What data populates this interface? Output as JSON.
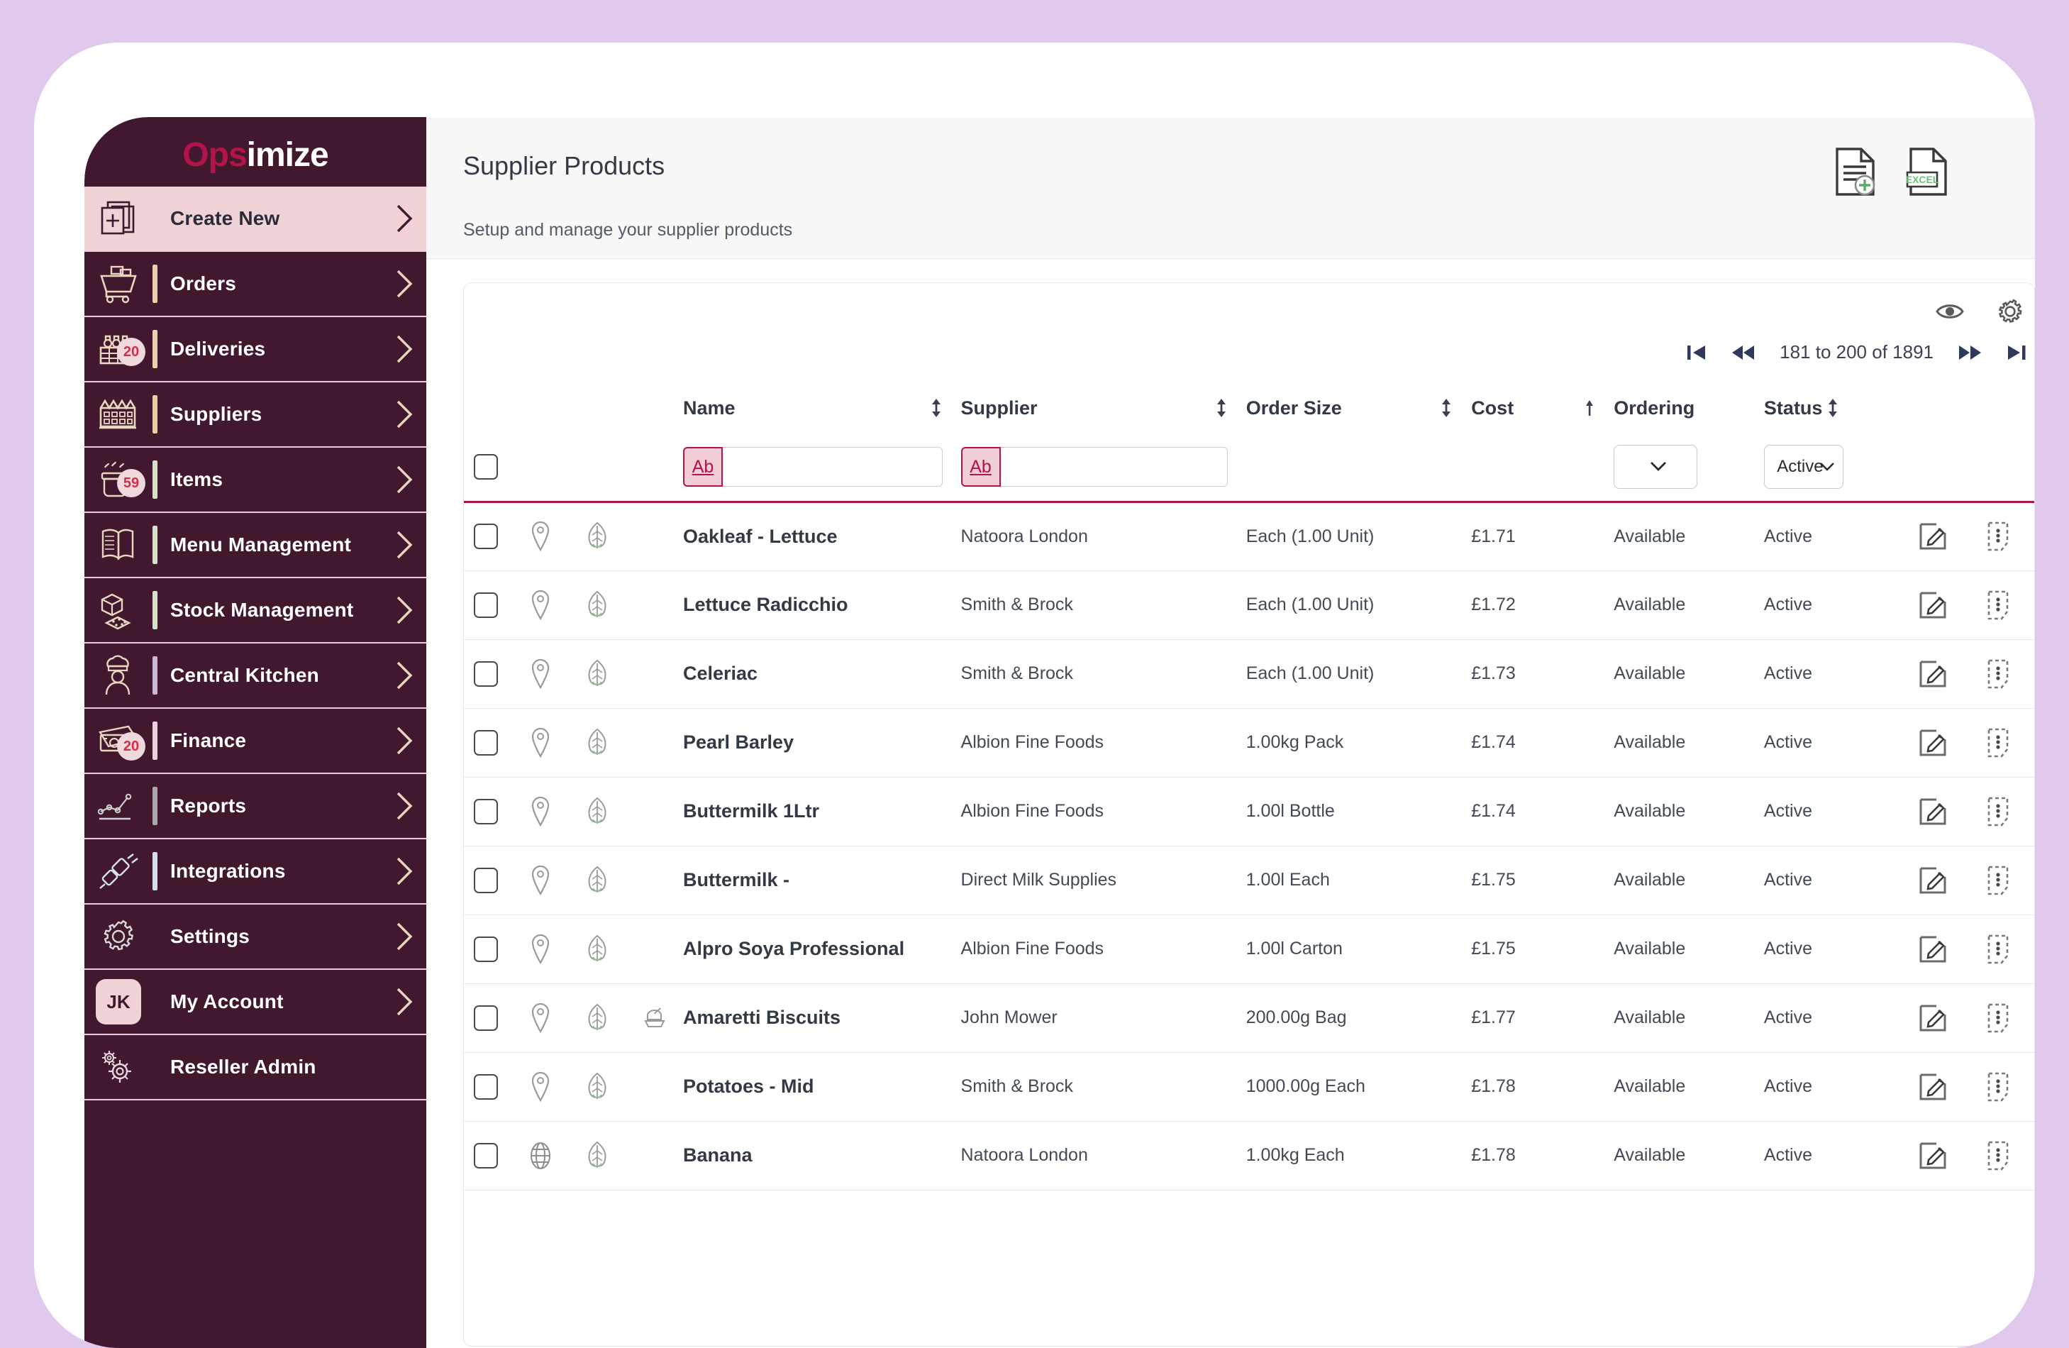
{
  "sidebar": {
    "brand": {
      "prefix": "Ops",
      "suffix": "imize"
    },
    "items": [
      {
        "label": "Create New",
        "icon": "copy-plus-icon",
        "badge": null,
        "accent": "none",
        "active": true,
        "chevron": true
      },
      {
        "label": "Orders",
        "icon": "cart-icon",
        "badge": null,
        "accent": "#e8d2a8",
        "active": false,
        "chevron": true
      },
      {
        "label": "Deliveries",
        "icon": "crate-icon",
        "badge": "20",
        "accent": "#e8d2a8",
        "active": false,
        "chevron": true
      },
      {
        "label": "Suppliers",
        "icon": "factory-icon",
        "badge": null,
        "accent": "#e8cfa0",
        "active": false,
        "chevron": true
      },
      {
        "label": "Items",
        "icon": "pot-icon",
        "badge": "59",
        "accent": "#cfe4c9",
        "active": false,
        "chevron": true
      },
      {
        "label": "Menu Management",
        "icon": "book-icon",
        "badge": null,
        "accent": "#cfe4c9",
        "active": false,
        "chevron": true
      },
      {
        "label": "Stock Management",
        "icon": "cube-icon",
        "badge": null,
        "accent": "#cfe4c9",
        "active": false,
        "chevron": true
      },
      {
        "label": "Central Kitchen",
        "icon": "chef-icon",
        "badge": null,
        "accent": "#c9b6d8",
        "active": false,
        "chevron": true
      },
      {
        "label": "Finance",
        "icon": "banknote-icon",
        "badge": "20",
        "accent": "#e6d2d8",
        "active": false,
        "chevron": true
      },
      {
        "label": "Reports",
        "icon": "linechart-icon",
        "badge": null,
        "accent": "#a9a9a9",
        "active": false,
        "chevron": true
      },
      {
        "label": "Integrations",
        "icon": "plug-icon",
        "badge": null,
        "accent": "#cfe1ef",
        "active": false,
        "chevron": true
      },
      {
        "label": "Settings",
        "icon": "gear-icon",
        "badge": null,
        "accent": "none",
        "active": false,
        "chevron": true
      },
      {
        "label": "My Account",
        "icon": "avatar-initials",
        "badge": null,
        "accent": "none",
        "active": false,
        "chevron": true,
        "initials": "JK"
      },
      {
        "label": "Reseller Admin",
        "icon": "gears-icon",
        "badge": null,
        "accent": "none",
        "active": false,
        "chevron": false
      }
    ]
  },
  "header": {
    "title": "Supplier Products",
    "subtitle": "Setup and manage your supplier products",
    "actions": [
      {
        "name": "new-document-icon",
        "label": ""
      },
      {
        "name": "excel-export-icon",
        "label": "EXCEL"
      }
    ]
  },
  "panel": {
    "tools": [
      {
        "name": "eye-icon"
      },
      {
        "name": "gear-icon"
      }
    ],
    "pagination": {
      "first_label": "⏮",
      "prev_label": "⏪",
      "range_text": "181 to 200 of 1891",
      "next_label": "⏩",
      "last_label": "⏭"
    }
  },
  "table": {
    "columns": [
      {
        "key": "name",
        "label": "Name",
        "sort": "both"
      },
      {
        "key": "supplier",
        "label": "Supplier",
        "sort": "both"
      },
      {
        "key": "ordersize",
        "label": "Order Size",
        "sort": "both"
      },
      {
        "key": "cost",
        "label": "Cost",
        "sort": "asc"
      },
      {
        "key": "ordering",
        "label": "Ordering",
        "sort": "none"
      },
      {
        "key": "status",
        "label": "Status",
        "sort": "both"
      }
    ],
    "filters": {
      "name_button": "Ab",
      "name_value": "",
      "name_placeholder": "",
      "supplier_button": "Ab",
      "supplier_value": "",
      "supplier_placeholder": "",
      "ordering_value": "",
      "status_value": "Active"
    },
    "rows": [
      {
        "name": "Oakleaf - Lettuce",
        "supplier": "Natoora London",
        "ordersize": "Each (1.00 Unit)",
        "cost": "£1.71",
        "ordering": "Available",
        "status": "Active",
        "loc_icon": "pin-icon",
        "leaf_icon": "leaf-icon",
        "extra_icon": null
      },
      {
        "name": "Lettuce Radicchio",
        "supplier": "Smith & Brock",
        "ordersize": "Each (1.00 Unit)",
        "cost": "£1.72",
        "ordering": "Available",
        "status": "Active",
        "loc_icon": "pin-icon",
        "leaf_icon": "leaf-icon",
        "extra_icon": null
      },
      {
        "name": "Celeriac",
        "supplier": "Smith & Brock",
        "ordersize": "Each (1.00 Unit)",
        "cost": "£1.73",
        "ordering": "Available",
        "status": "Active",
        "loc_icon": "pin-icon",
        "leaf_icon": "leaf-icon",
        "extra_icon": null
      },
      {
        "name": "Pearl Barley",
        "supplier": "Albion Fine Foods",
        "ordersize": "1.00kg Pack",
        "cost": "£1.74",
        "ordering": "Available",
        "status": "Active",
        "loc_icon": "pin-icon",
        "leaf_icon": "leaf-icon",
        "extra_icon": null
      },
      {
        "name": "Buttermilk 1Ltr",
        "supplier": "Albion Fine Foods",
        "ordersize": "1.00l Bottle",
        "cost": "£1.74",
        "ordering": "Available",
        "status": "Active",
        "loc_icon": "pin-icon",
        "leaf_icon": "leaf-icon",
        "extra_icon": null
      },
      {
        "name": "Buttermilk -",
        "supplier": "Direct Milk Supplies",
        "ordersize": "1.00l Each",
        "cost": "£1.75",
        "ordering": "Available",
        "status": "Active",
        "loc_icon": "pin-icon",
        "leaf_icon": "leaf-icon",
        "extra_icon": null
      },
      {
        "name": "Alpro Soya Professional",
        "supplier": "Albion Fine Foods",
        "ordersize": "1.00l Carton",
        "cost": "£1.75",
        "ordering": "Available",
        "status": "Active",
        "loc_icon": "pin-icon",
        "leaf_icon": "leaf-icon",
        "extra_icon": null
      },
      {
        "name": "Amaretti Biscuits",
        "supplier": "John Mower",
        "ordersize": "200.00g Bag",
        "cost": "£1.77",
        "ordering": "Available",
        "status": "Active",
        "loc_icon": "pin-icon",
        "leaf_icon": "leaf-icon",
        "extra_icon": "allergen-icon"
      },
      {
        "name": "Potatoes - Mid",
        "supplier": "Smith & Brock",
        "ordersize": "1000.00g Each",
        "cost": "£1.78",
        "ordering": "Available",
        "status": "Active",
        "loc_icon": "pin-icon",
        "leaf_icon": "leaf-icon",
        "extra_icon": null
      },
      {
        "name": "Banana",
        "supplier": "Natoora London",
        "ordersize": "1.00kg Each",
        "cost": "£1.78",
        "ordering": "Available",
        "status": "Active",
        "loc_icon": "globe-icon",
        "leaf_icon": "leaf-icon",
        "extra_icon": null
      }
    ],
    "row_actions": [
      {
        "name": "edit-icon"
      },
      {
        "name": "row-menu-icon"
      }
    ]
  },
  "colors": {
    "background": "#e0c9ec",
    "sidebar": "#42182f",
    "brand_accent": "#b2134a",
    "active_nav": "#efd3d7",
    "filter_underline": "#b2134a"
  }
}
